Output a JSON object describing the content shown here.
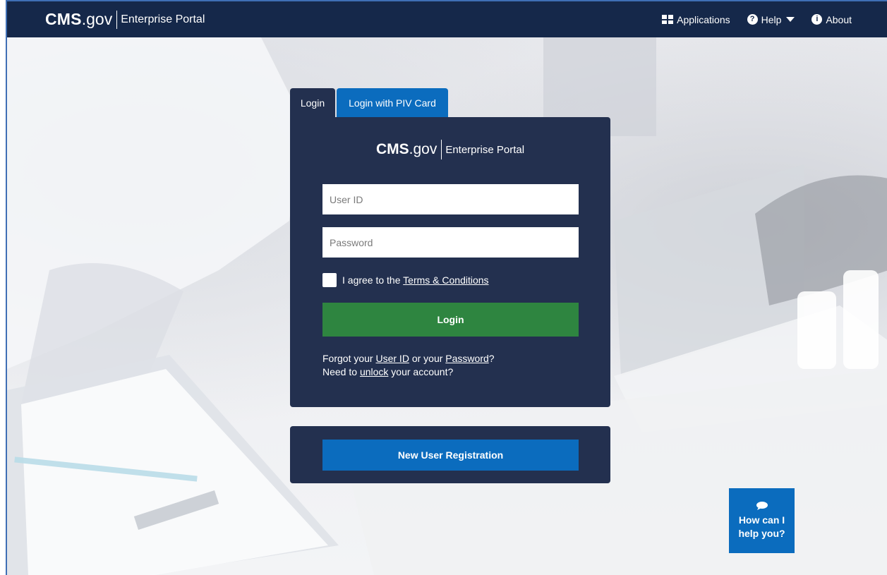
{
  "header": {
    "brand_cms": "CMS",
    "brand_gov": ".gov",
    "brand_portal": "Enterprise Portal",
    "nav": {
      "applications": "Applications",
      "help": "Help",
      "about": "About"
    }
  },
  "tabs": {
    "login": "Login",
    "piv": "Login with PIV Card"
  },
  "login_card": {
    "brand_cms": "CMS",
    "brand_gov": ".gov",
    "brand_portal": "Enterprise Portal",
    "userid_placeholder": "User ID",
    "password_placeholder": "Password",
    "agree_prefix": "I agree to the",
    "terms_link": "Terms & Conditions",
    "login_button": "Login",
    "forgot_prefix": "Forgot your",
    "forgot_userid_link": "User ID",
    "forgot_or": "or your",
    "forgot_password_link": "Password",
    "forgot_suffix": "?",
    "unlock_prefix": "Need to",
    "unlock_link": "unlock",
    "unlock_suffix": "your account?"
  },
  "registration": {
    "button": "New User Registration"
  },
  "chat": {
    "line1": "How can I",
    "line2": "help you?"
  },
  "colors": {
    "nav_bg": "#15284a",
    "card_bg": "#23304f",
    "login_green": "#2e8540",
    "primary_blue": "#0b6cbe"
  },
  "icons": {
    "applications": "grid-icon",
    "help": "question-circle-icon",
    "help_caret": "caret-down-icon",
    "about": "info-circle-icon",
    "chat": "chat-bubble-icon"
  }
}
